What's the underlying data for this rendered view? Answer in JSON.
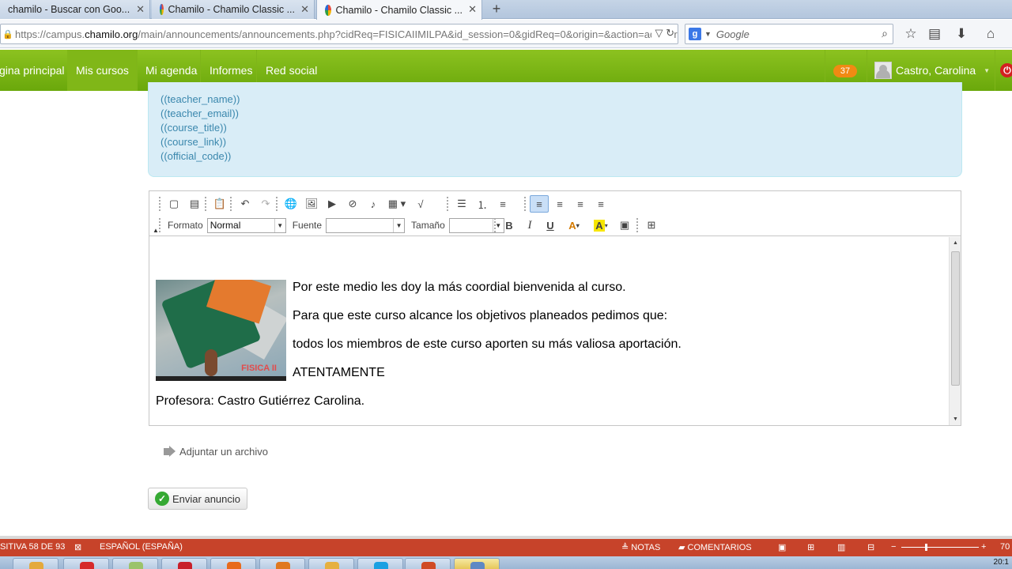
{
  "browser": {
    "tabs": [
      {
        "title": "chamilo - Buscar con Goo...",
        "active": false
      },
      {
        "title": "Chamilo - Chamilo Classic ...",
        "active": false
      },
      {
        "title": "Chamilo - Chamilo Classic ...",
        "active": true
      }
    ],
    "url": {
      "prefix": "https://campus.",
      "domain": "chamilo.org",
      "path": "/main/announcements/announcements.php?cidReq=FISICAIIMILPA&id_session=0&gidReq=0&origin=&action=add&orig"
    },
    "search_placeholder": "Google"
  },
  "site_nav": {
    "items": [
      "gina principal",
      "Mis cursos",
      "Mi agenda",
      "Informes",
      "Red social"
    ],
    "active_index": 1,
    "notifications": "37",
    "user_name": "Castro, Carolina"
  },
  "tags": [
    "((teacher_name))",
    "((teacher_email))",
    "((course_title))",
    "((course_link))",
    "((official_code))"
  ],
  "editor": {
    "labels": {
      "format": "Formato",
      "font": "Fuente",
      "size": "Tamaño"
    },
    "format_value": "Normal",
    "font_value": "",
    "size_value": "",
    "image_caption": "FISICA II",
    "content": [
      "Por este medio les doy la más coordial bienvenida al curso.",
      "Para que este curso alcance los objetivos planeados pedimos que:",
      "todos los miembros de este curso aporten su más valiosa aportación.",
      "ATENTAMENTE",
      "Profesora: Castro Gutiérrez Carolina."
    ]
  },
  "attach_label": "Adjuntar un archivo",
  "submit_label": "Enviar anuncio",
  "statusbar": {
    "slide": "SITIVA 58 DE 93",
    "language": "ESPAÑOL (ESPAÑA)",
    "notes": "NOTAS",
    "comments": "COMENTARIOS",
    "zoom": "70"
  },
  "taskbar": {
    "clock": "20:1"
  }
}
